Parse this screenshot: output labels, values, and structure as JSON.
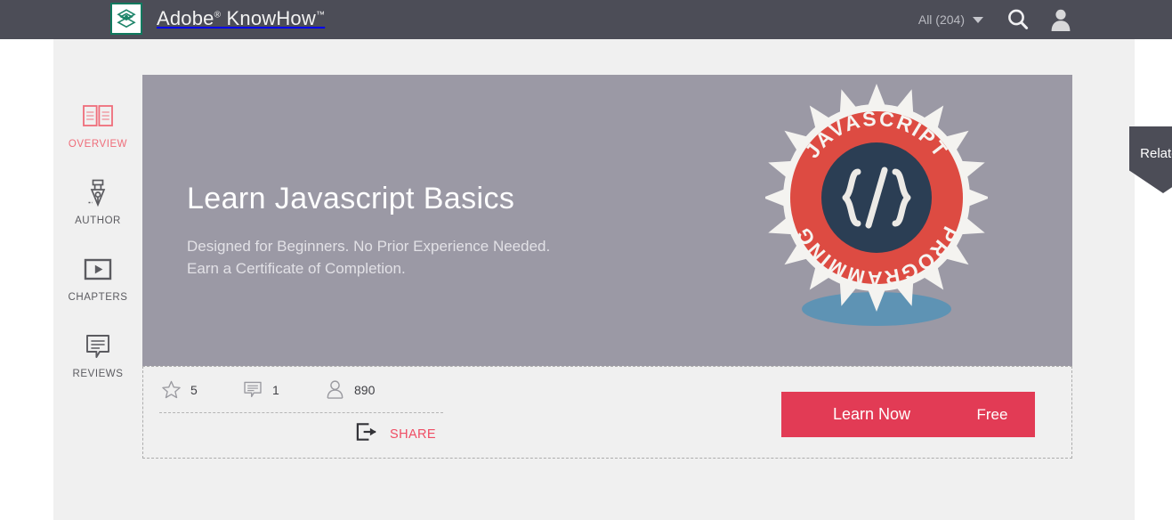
{
  "header": {
    "brand_name": "Adobe",
    "brand_reg": "®",
    "brand_product": " KnowHow",
    "brand_tm": "™",
    "logo_icon": "adobe-knowhow-layers-icon",
    "filter_label": "All (204)",
    "filter_caret_icon": "chevron-down-icon",
    "search_icon": "search-icon",
    "account_icon": "user-avatar-icon",
    "bar_color": "#4c4d57"
  },
  "sidebar": {
    "items": [
      {
        "label": "OVERVIEW",
        "icon": "open-book-icon",
        "active": true
      },
      {
        "label": "AUTHOR",
        "icon": "pen-nib-icon",
        "active": false
      },
      {
        "label": "CHAPTERS",
        "icon": "video-play-icon",
        "active": false
      },
      {
        "label": "REVIEWS",
        "icon": "comment-bubble-icon",
        "active": false
      }
    ],
    "active_color": "#ef6d7a",
    "inactive_color": "#5b5b60"
  },
  "ribbon": {
    "label": "Related",
    "shape": "pentagon-bookmark",
    "color": "#4c4d57"
  },
  "hero": {
    "title": "Learn Javascript Basics",
    "subtitle_line1": "Designed for Beginners. No Prior Experience Needed.",
    "subtitle_line2": "Earn a Certificate of Completion.",
    "background_color": "#9b99a5",
    "badge": {
      "icon": "javascript-programming-badge-icon",
      "top_arc_text": "JAVASCRIPT",
      "bottom_arc_text": "PROGRAMMING",
      "center_symbol": "{/}",
      "ring_color": "#dd4b42",
      "center_color": "#2b3e54",
      "burst_color": "#f4f3f0",
      "shadow_color": "#5e93b4"
    }
  },
  "stats": [
    {
      "icon": "star-icon",
      "name": "rating-stat",
      "value": "5"
    },
    {
      "icon": "comment-icon",
      "name": "comments-stat",
      "value": "1"
    },
    {
      "icon": "person-icon",
      "name": "learners-stat",
      "value": "890"
    }
  ],
  "share": {
    "label": "SHARE",
    "icon": "share-export-icon",
    "color": "#ef4d64"
  },
  "cta": {
    "action_label": "Learn Now",
    "price_label": "Free",
    "color": "#e23b55"
  }
}
